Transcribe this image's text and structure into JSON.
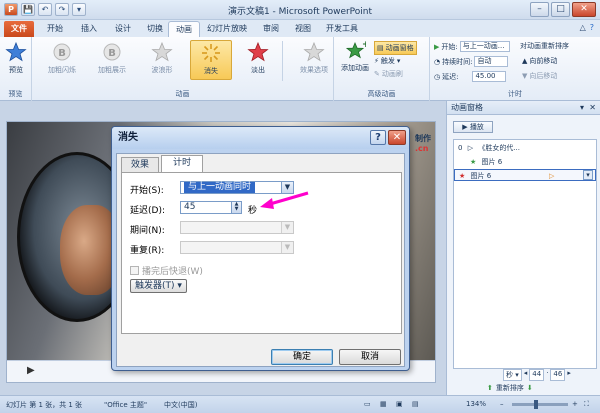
{
  "window": {
    "title": "演示文稿1 - Microsoft PowerPoint",
    "controls": {
      "minimize": "–",
      "maximize": "□",
      "close": "✕"
    }
  },
  "qat": {
    "save": "💾",
    "undo": "↶",
    "redo": "↷",
    "more": "▾"
  },
  "tabs": {
    "file": "文件",
    "items": [
      "开始",
      "插入",
      "设计",
      "切换",
      "动画",
      "幻灯片放映",
      "审阅",
      "视图",
      "开发工具"
    ],
    "active": "动画"
  },
  "ribbon": {
    "preview": {
      "label": "预览",
      "group": "预览"
    },
    "effects": [
      "加粗闪烁",
      "加粗展示",
      "波浪形",
      "消失",
      "淡出"
    ],
    "effect_options": "效果选项",
    "group_animation": "动画",
    "add_animation": "添加动画",
    "animation_pane": "动画窗格",
    "trigger": "触发",
    "animation_painter": "动画刷",
    "group_advanced": "高级动画",
    "start_label": "开始:",
    "start_value": "与上一动画...",
    "duration_label": "持续时间:",
    "duration_value": "自动",
    "delay_label": "延迟:",
    "delay_value": "45.00",
    "reorder_title": "对动画重新排序",
    "move_earlier": "向前移动",
    "move_later": "向后移动",
    "group_timing": "计时"
  },
  "slide": {
    "brand_line1": "制作",
    "brand_line2": ".cn"
  },
  "pane": {
    "title": "动画窗格",
    "play": "播放",
    "items": [
      {
        "index": "0",
        "icon": "▷",
        "text": "《胜女的代..."
      },
      {
        "index": "",
        "icon": "★",
        "text": "图片 6"
      },
      {
        "index": "",
        "icon": "★",
        "text": "图片 6"
      }
    ],
    "footer_seconds": "秒 ▾",
    "footer_left": "44",
    "footer_right": "46",
    "reorder": "重新排序"
  },
  "dialog": {
    "title": "消失",
    "help": "?",
    "close": "✕",
    "tab_effect": "效果",
    "tab_timing": "计时",
    "start_label": "开始(S):",
    "start_value": "与上一动画同时",
    "delay_label": "延迟(D):",
    "delay_value": "45",
    "delay_unit": "秒",
    "period_label": "期间(N):",
    "repeat_label": "重复(R):",
    "rewind_label": "播完后快退(W)",
    "trigger_button": "触发器(T) ▾",
    "ok": "确定",
    "cancel": "取消"
  },
  "status": {
    "slide_info": "幻灯片 第 1 张，共 1 张",
    "theme": "\"Office 主题\"",
    "language": "中文(中国)",
    "zoom": "134%"
  },
  "colors": {
    "accent_arrow": "#ff00cc",
    "file_tab": "#d5582c",
    "selection": "#3169c6"
  }
}
